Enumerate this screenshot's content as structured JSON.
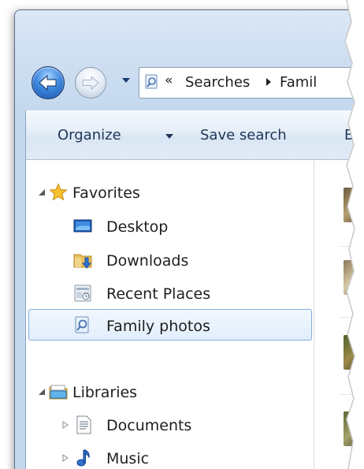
{
  "address": {
    "overflow_chevron": "«",
    "crumb1": "Searches",
    "crumb2": "Famil"
  },
  "commands": {
    "organize": "Organize",
    "save_search": "Save search",
    "truncated": "B"
  },
  "nav_tree": {
    "favorites": "Favorites",
    "desktop": "Desktop",
    "downloads": "Downloads",
    "recent_places": "Recent Places",
    "family_photos": "Family photos",
    "libraries": "Libraries",
    "documents": "Documents",
    "music": "Music"
  },
  "icons": {
    "back": "back-arrow-icon",
    "forward": "forward-arrow-icon",
    "search_folder": "saved-search-icon",
    "favorites": "star-icon",
    "desktop": "desktop-icon",
    "downloads": "downloads-folder-icon",
    "recent_places": "recent-places-icon",
    "libraries": "library-icon",
    "documents": "document-icon",
    "music": "music-note-icon"
  },
  "colors": {
    "selection_border": "#84acdd",
    "command_text": "#1e3555",
    "back_button": "#2f74cf"
  }
}
